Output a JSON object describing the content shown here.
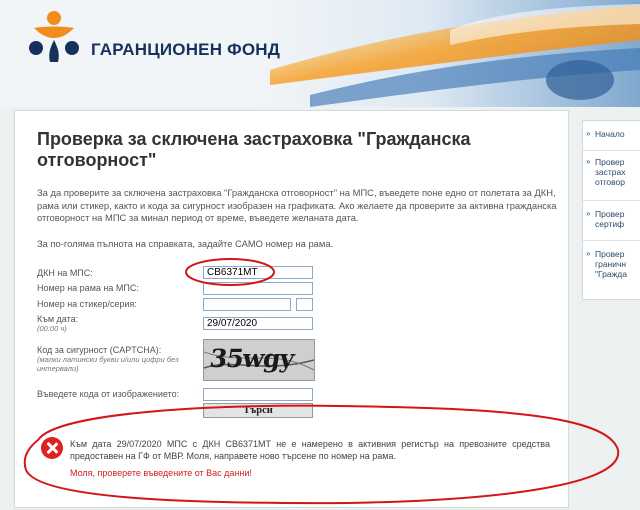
{
  "header": {
    "brand_name": "ГАРАНЦИОНЕН ФОНД",
    "logo_icon": "people-circle-logo-icon",
    "colors": {
      "brand_blue": "#16325c",
      "brand_orange": "#f28c1c"
    }
  },
  "main": {
    "title": "Проверка за сключена застраховка \"Гражданска отговорност\"",
    "intro": "За да проверите за сключена застраховка \"Гражданска отговорност\" на МПС, въведете поне едно от полетата за ДКН, рама или стикер, както и кода за сигурност изобразен на графиката. Ако желаете да проверите за активна гражданска отговорност на МПС за минал период от време, въведете желаната дата.",
    "hint": "За по-голяма пълнота на справката, задайте САМО номер на рама."
  },
  "form": {
    "plate_label": "ДКН на МПС:",
    "plate_value": "СВ6371МТ",
    "frame_label": "Номер на рама на МПС:",
    "frame_value": "",
    "sticker_label": "Номер на стикер/серия:",
    "sticker_value": "",
    "series_value": "",
    "date_label": "Към дата:",
    "date_hint": "(00:00 ч)",
    "date_value": "29/07/2020",
    "captcha_label": "Код за сигурност (CAPTCHA):",
    "captcha_hint": "(малки латински букви и/или цифри без интервали)",
    "captcha_text": "35wgy",
    "code_label": "Въведете кода от изображението:",
    "code_value": "",
    "search_label": "Търси"
  },
  "error": {
    "icon": "error-x-icon",
    "message": "Към дата 29/07/2020 МПС с ДКН СВ6371МТ не е намерено в активния регистър на превозните средства предоставен на ГФ от МВР. Моля, направете ново търсене по номер на рама.",
    "note": "Моля, проверете въведените от Вас данни!",
    "color": "#d02020"
  },
  "sidebar": {
    "items": [
      {
        "label": "Начало"
      },
      {
        "label": "Провер\nзастрах\nотговор"
      },
      {
        "label": "Провер\nсертиф"
      },
      {
        "label": "Провер\nграничн\n\"Гражда"
      }
    ]
  }
}
